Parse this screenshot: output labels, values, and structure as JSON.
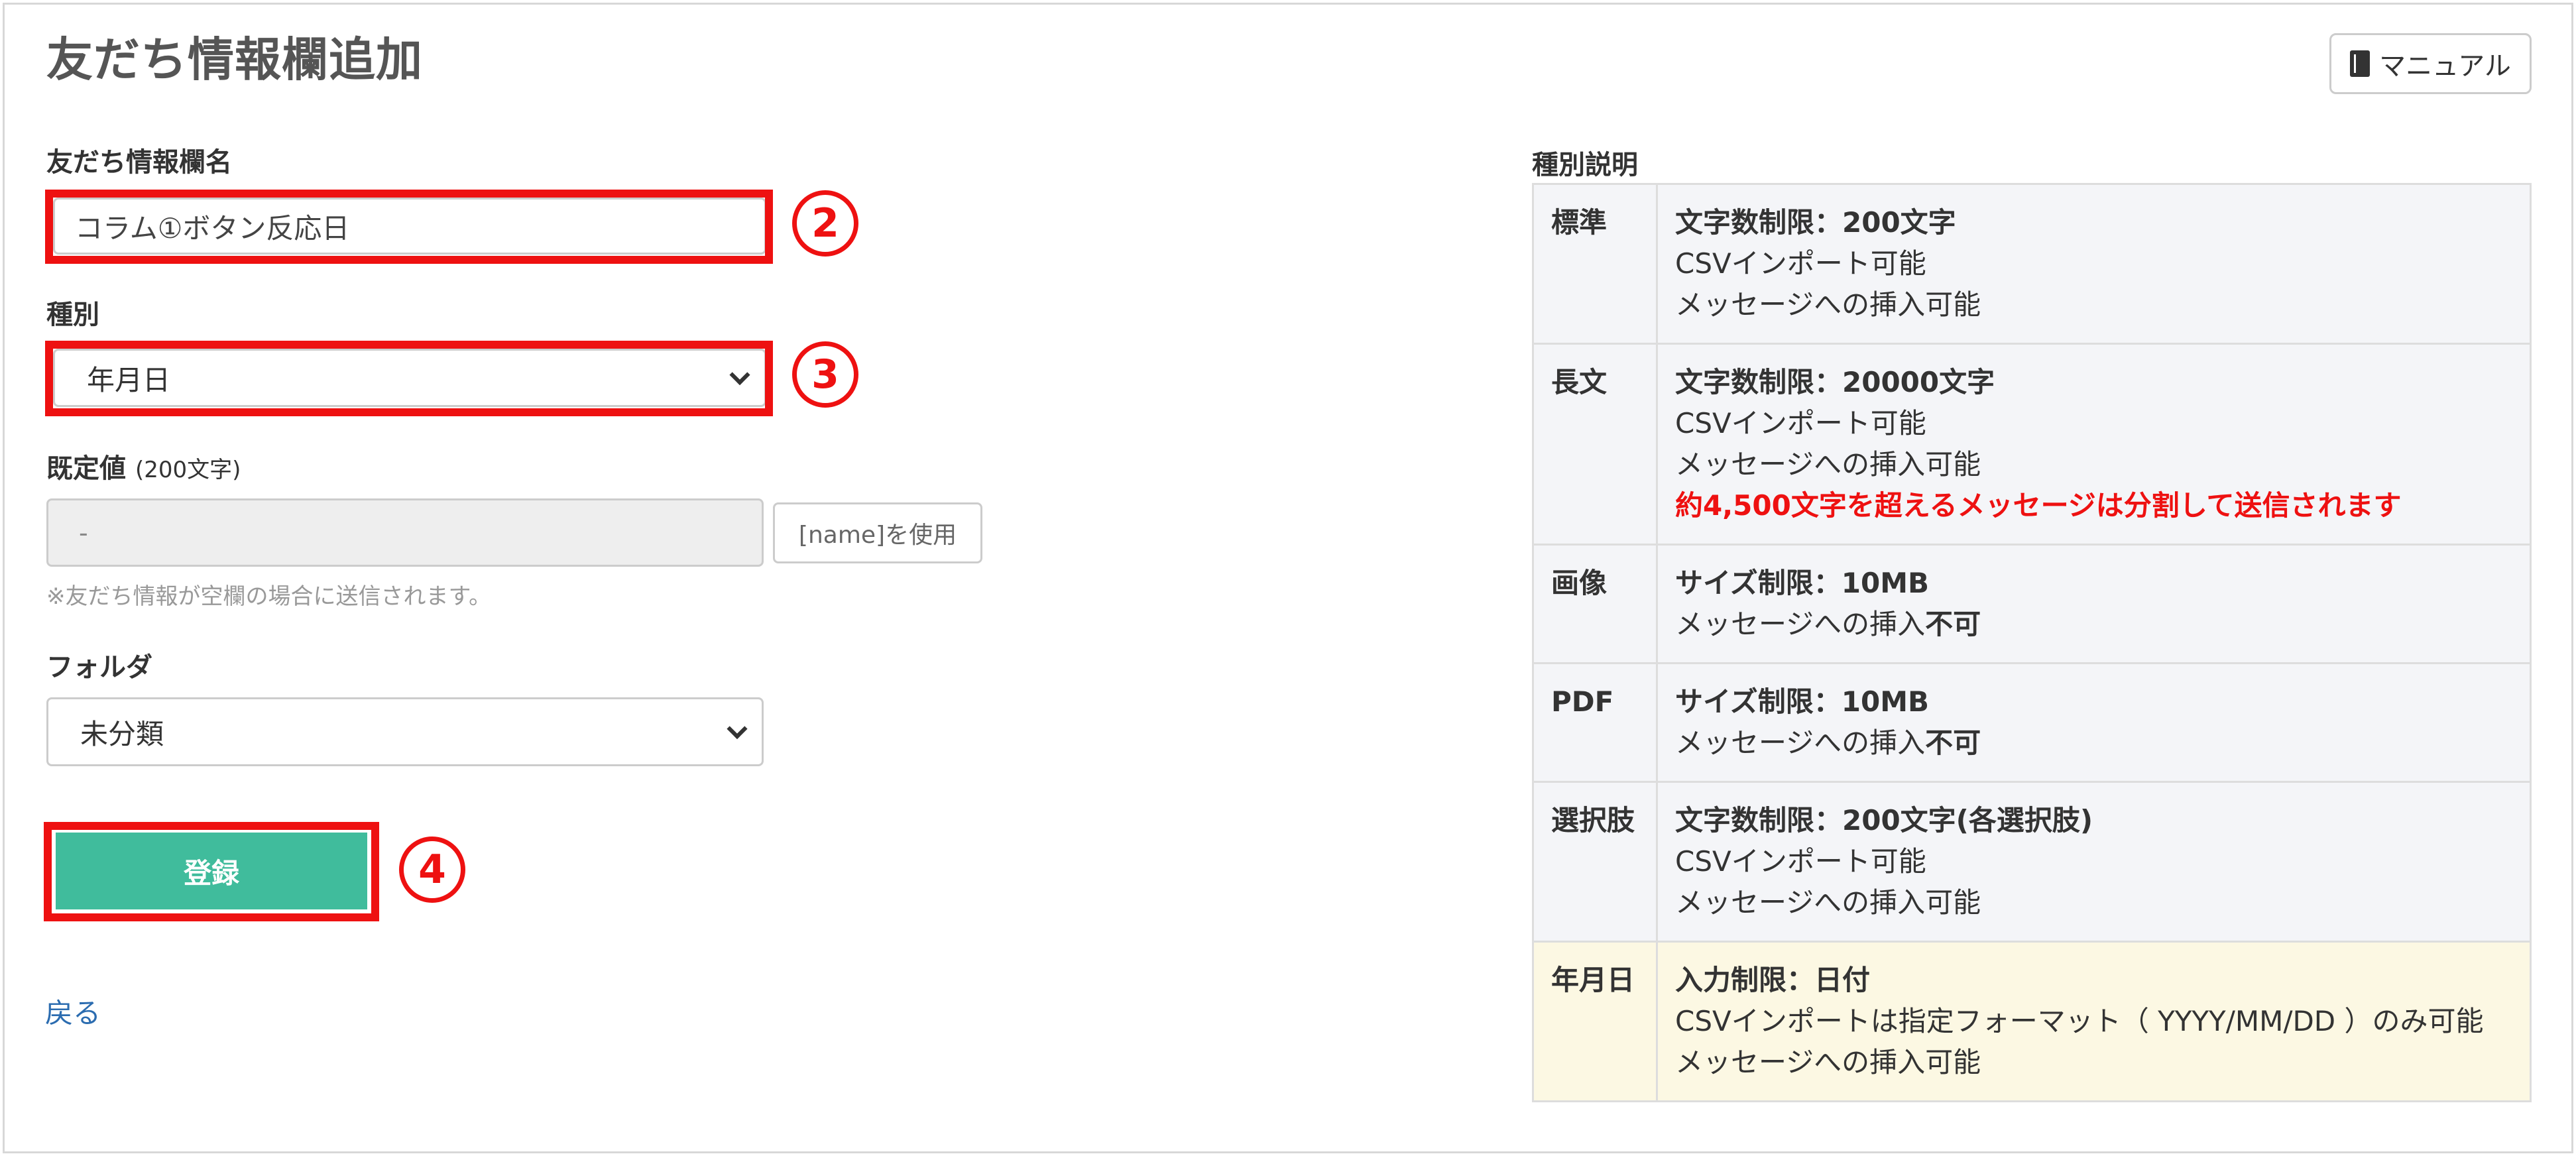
{
  "page": {
    "title": "友だち情報欄追加",
    "manual_label": "マニュアル"
  },
  "form": {
    "name_label": "友だち情報欄名",
    "name_value": "コラム①ボタン反応日",
    "type_label": "種別",
    "type_value": "年月日",
    "default_label": "既定値",
    "default_sub": "(200文字)",
    "default_value": "-",
    "name_tag_button": "[name]を使用",
    "default_note": "※友だち情報が空欄の場合に送信されます。",
    "folder_label": "フォルダ",
    "folder_value": "未分類",
    "submit_label": "登録",
    "back_label": "戻る"
  },
  "annotations": {
    "step2": "2",
    "step3": "3",
    "step4": "4"
  },
  "types_panel": {
    "heading": "種別説明",
    "rows": [
      {
        "type": "標準",
        "limit": "文字数制限：200文字",
        "line1": "CSVインポート可能",
        "line2": "メッセージへの挿入可能"
      },
      {
        "type": "長文",
        "limit": "文字数制限：20000文字",
        "line1": "CSVインポート可能",
        "line2": "メッセージへの挿入可能",
        "warning": "約4,500文字を超えるメッセージは分割して送信されます"
      },
      {
        "type": "画像",
        "limit": "サイズ制限：10MB",
        "line1_prefix": "メッセージへの挿入",
        "line1_emph": "不可"
      },
      {
        "type": "PDF",
        "limit": "サイズ制限：10MB",
        "line1_prefix": "メッセージへの挿入",
        "line1_emph": "不可"
      },
      {
        "type": "選択肢",
        "limit": "文字数制限：200文字(各選択肢)",
        "line1": "CSVインポート可能",
        "line2": "メッセージへの挿入可能"
      },
      {
        "type": "年月日",
        "limit": "入力制限：日付",
        "line1": "CSVインポートは指定フォーマット（ YYYY/MM/DD ）のみ可能",
        "line2": "メッセージへの挿入可能"
      }
    ]
  },
  "colors": {
    "accent_green": "#40bc9c",
    "highlight_red": "#ee1111",
    "link_blue": "#2b6cb0",
    "date_row_bg": "#fcf8e3"
  },
  "icons": {
    "manual": "book-icon",
    "select": "chevron-down-icon"
  }
}
